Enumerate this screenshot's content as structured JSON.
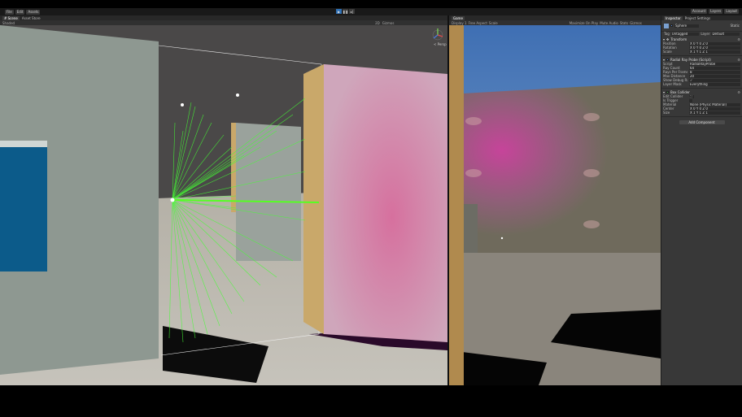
{
  "window": {
    "title": "Unity Editor"
  },
  "toolbar": {
    "account_items": [
      "File",
      "Edit",
      "Assets"
    ],
    "play_buttons": [
      "play-icon",
      "pause-icon",
      "step-icon"
    ],
    "right_items": [
      "Account",
      "Layers",
      "Layout"
    ],
    "colors": {
      "play_active": "#2f6fb3",
      "bar": "#191919"
    }
  },
  "scene_panel": {
    "tabs": [
      "# Scene",
      "Asset Store"
    ],
    "toolbar_items": [
      "Shaded",
      "2D",
      "Gizmos"
    ],
    "persp_label": "< Persp"
  },
  "game_panel": {
    "tabs": [
      "Game"
    ],
    "toolbar_items": [
      "Display 1",
      "Free Aspect",
      "Scale",
      "Maximize On Play",
      "Mute Audio",
      "Stats",
      "Gizmos"
    ]
  },
  "inspector": {
    "tabs": [
      "Inspector",
      "Project Settings"
    ],
    "object_name": "Sphere",
    "tag_label": "Tag",
    "tag_value": "Untagged",
    "layer_label": "Layer",
    "layer_value": "Default",
    "static_label": "Static",
    "components": [
      {
        "title": "Transform",
        "rows": [
          {
            "label": "Position",
            "value": "X 0   Y 0   Z 0"
          },
          {
            "label": "Rotation",
            "value": "X 0   Y 0   Z 0"
          },
          {
            "label": "Scale",
            "value": "X 1   Y 1   Z 1"
          }
        ]
      },
      {
        "title": "Radial Ray Probe (Script)",
        "rows": [
          {
            "label": "Script",
            "value": "RadialRayProbe"
          },
          {
            "label": "Ray Count",
            "value": "64"
          },
          {
            "label": "Rays Per Frame",
            "value": "8"
          },
          {
            "label": "Max Distance",
            "value": "20"
          },
          {
            "label": "Show Debug Rays",
            "value": "✓"
          },
          {
            "label": "Layer Mask",
            "value": "Everything"
          }
        ]
      },
      {
        "title": "Box Collider",
        "rows": [
          {
            "label": "Edit Collider",
            "value": "⛶"
          },
          {
            "label": "Is Trigger",
            "value": ""
          },
          {
            "label": "Material",
            "value": "None (Physic Material)"
          },
          {
            "label": "Center",
            "value": "X 0   Y 0   Z 0"
          },
          {
            "label": "Size",
            "value": "X 1   Y 1   Z 1"
          }
        ]
      }
    ],
    "add_component_label": "Add Component"
  }
}
